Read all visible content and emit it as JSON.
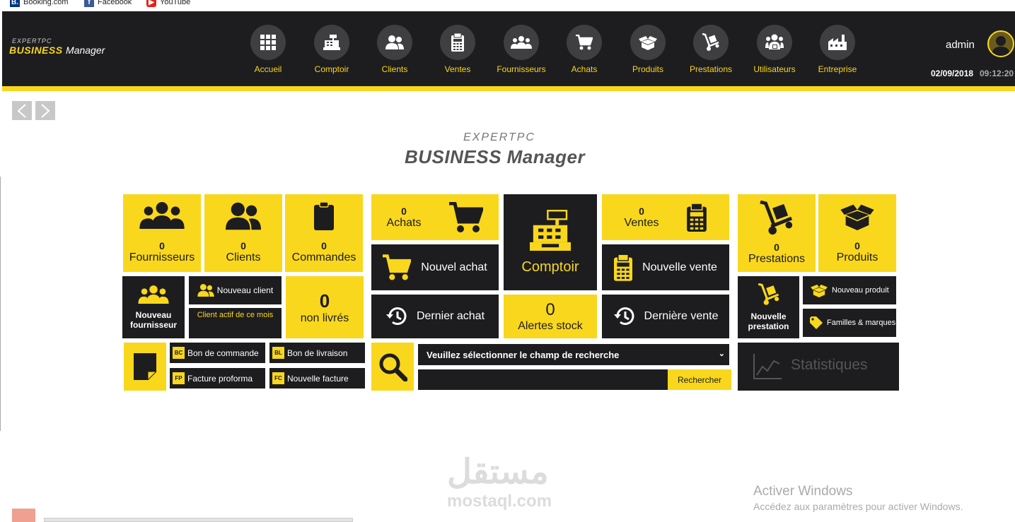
{
  "bookmarks": [
    {
      "label": "Booking.com",
      "icon": "booking-icon",
      "badge": "B.",
      "color": "#003580"
    },
    {
      "label": "Facebook",
      "icon": "facebook-icon",
      "badge": "f",
      "color": "#3b5998"
    },
    {
      "label": "YouTube",
      "icon": "youtube-icon",
      "badge": "▶",
      "color": "#e62117"
    }
  ],
  "header": {
    "brand_top": "EXPERTPC",
    "brand_biz": "BUSINESS",
    "brand_mgr": "Manager",
    "user": "admin",
    "date": "02/09/2018",
    "time": "09:12:20"
  },
  "nav": [
    {
      "label": "Accueil",
      "icon": "grid-icon"
    },
    {
      "label": "Comptoir",
      "icon": "cash-register-icon"
    },
    {
      "label": "Clients",
      "icon": "users-icon"
    },
    {
      "label": "Ventes",
      "icon": "calculator-icon"
    },
    {
      "label": "Fournisseurs",
      "icon": "group-icon"
    },
    {
      "label": "Achats",
      "icon": "cart-icon"
    },
    {
      "label": "Produits",
      "icon": "box-icon"
    },
    {
      "label": "Prestations",
      "icon": "hand-truck-icon"
    },
    {
      "label": "Utilisateurs",
      "icon": "user-lock-icon"
    },
    {
      "label": "Entreprise",
      "icon": "factory-icon"
    }
  ],
  "logo": {
    "top": "EXPERTPC",
    "main": "BUSINESS Manager"
  },
  "tiles": {
    "fournisseurs": {
      "value": "0",
      "label": "Fournisseurs"
    },
    "clients": {
      "value": "0",
      "label": "Clients"
    },
    "commandes": {
      "value": "0",
      "label": "Commandes"
    },
    "nouveau_fournisseur": "Nouveau fournisseur",
    "nouveau_client": "Nouveau client",
    "client_actif": "Client actif de ce mois",
    "non_livres": {
      "value": "0",
      "label": "non livrés"
    },
    "bon_commande": {
      "chip": "BC",
      "label": "Bon de commande"
    },
    "bon_livraison": {
      "chip": "BL",
      "label": "Bon de livraison"
    },
    "facture_proforma": {
      "chip": "FP",
      "label": "Facture proforma"
    },
    "nouvelle_facture": {
      "chip": "FC",
      "label": "Nouvelle facture"
    },
    "achats": {
      "value": "0",
      "label": "Achats"
    },
    "nouvel_achat": "Nouvel achat",
    "dernier_achat": "Dernier achat",
    "comptoir": "Comptoir",
    "alertes_stock": {
      "value": "0",
      "label": "Alertes stock"
    },
    "ventes": {
      "value": "0",
      "label": "Ventes"
    },
    "nouvelle_vente": "Nouvelle vente",
    "derniere_vente": "Dernière vente",
    "prestations": {
      "value": "0",
      "label": "Prestations"
    },
    "produits": {
      "value": "0",
      "label": "Produits"
    },
    "nouvelle_prestation": "Nouvelle prestation",
    "nouveau_produit": "Nouveau produit",
    "familles_marques": "Familles & marques",
    "statistiques": "Statistiques"
  },
  "search": {
    "select_value": "Veuillez sélectionner le champ de recherche",
    "button": "Rechercher"
  },
  "watermark": {
    "arabic": "مستقل",
    "url": "mostaql.com"
  },
  "windows": {
    "line1": "Activer Windows",
    "line2": "Accédez aux paramètres pour activer Windows."
  }
}
